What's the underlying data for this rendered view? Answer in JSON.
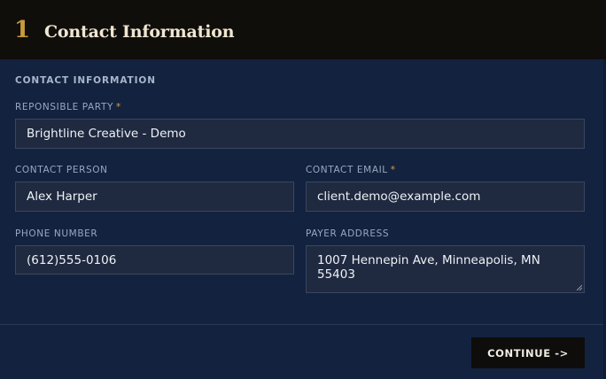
{
  "header": {
    "step_number": "1",
    "title": "Contact Information"
  },
  "form": {
    "section_title": "CONTACT INFORMATION",
    "responsible_party": {
      "label": "REPONSIBLE PARTY",
      "required_mark": "*",
      "value": "Brightline Creative - Demo"
    },
    "contact_person": {
      "label": "CONTACT PERSON",
      "value": "Alex Harper"
    },
    "contact_email": {
      "label": "CONTACT EMAIL",
      "required_mark": "*",
      "value": "client.demo@example.com"
    },
    "phone_number": {
      "label": "PHONE NUMBER",
      "value": "(612)555-0106"
    },
    "payer_address": {
      "label": "PAYER ADDRESS",
      "value": "1007 Hennepin Ave, Minneapolis, MN 55403"
    }
  },
  "footer": {
    "continue_label": "CONTINUE ->"
  },
  "colors": {
    "header_bg": "#100e0b",
    "body_bg": "#13223f",
    "accent_gold": "#c79a3c",
    "field_bg": "#1f2a40"
  }
}
